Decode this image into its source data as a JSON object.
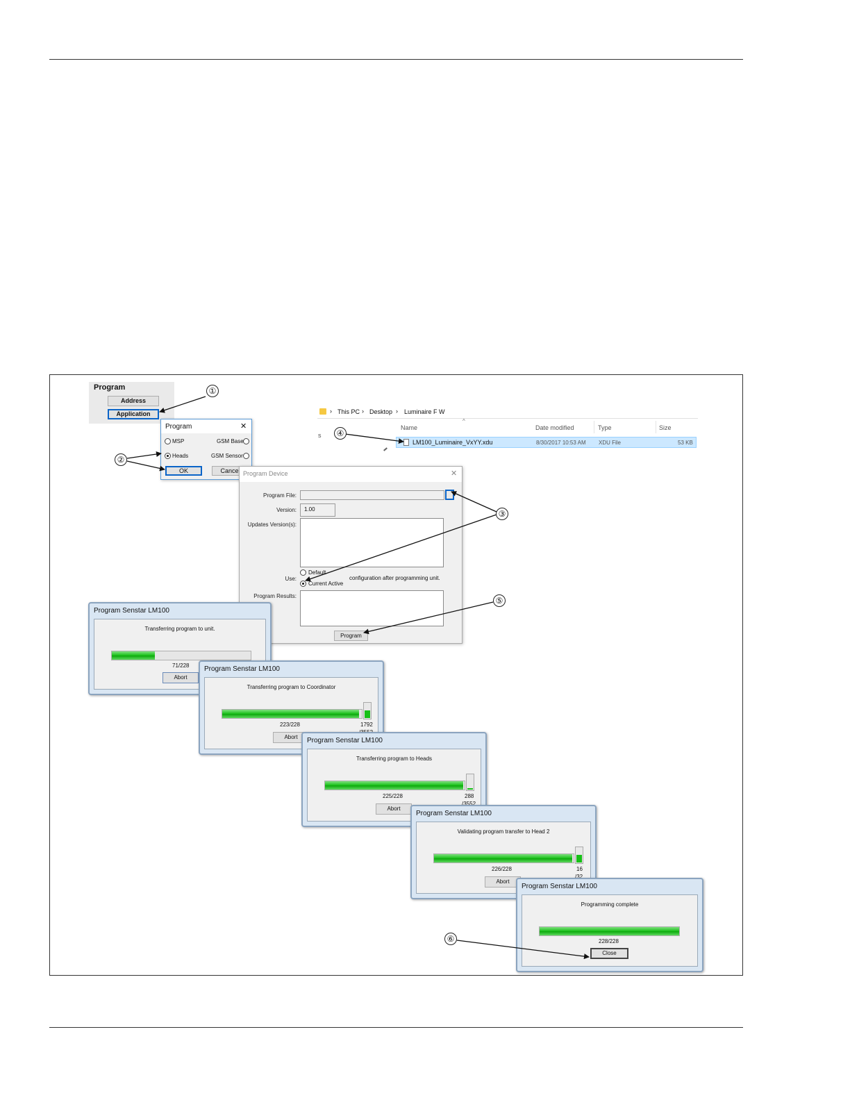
{
  "program_panel": {
    "title": "Program",
    "address_button": "Address",
    "application_button": "Application"
  },
  "program_dialog": {
    "title": "Program",
    "close_glyph": "✕",
    "option_msp": "MSP",
    "option_heads": "Heads",
    "option_gsm_base": "GSM Base",
    "option_gsm_sensor": "GSM Sensor",
    "ok_button": "OK",
    "cancel_button": "Cancel",
    "selected": "Heads"
  },
  "explorer": {
    "breadcrumb": [
      "This PC",
      "Desktop",
      "Luminaire F W"
    ],
    "separator": "›",
    "columns": {
      "name": "Name",
      "date": "Date modified",
      "type": "Type",
      "size": "Size"
    },
    "sort_glyph": "^",
    "side_letter": "s",
    "file": {
      "name": "LM100_Luminaire_VxYY.xdu",
      "date": "8/30/2017 10:53 AM",
      "type": "XDU File",
      "size": "53 KB"
    }
  },
  "program_device": {
    "title": "Program Device",
    "close_glyph": "✕",
    "program_file_label": "Program File:",
    "version_label": "Version:",
    "version_value": "1.00",
    "updates_label": "Updates Version(s):",
    "use_label": "Use:",
    "option_default": "Default",
    "option_current": "Current Active",
    "use_suffix": "configuration after programming unit.",
    "results_label": "Program Results:",
    "program_button": "Program"
  },
  "progress_windows": [
    {
      "title": "Program Senstar LM100",
      "message": "Transferring program to unit.",
      "progress": 0.31,
      "count": "71/228",
      "button": "Abort"
    },
    {
      "title": "Program Senstar LM100",
      "message": "Transferring program to Coordinator",
      "progress": 0.98,
      "count": "223/228",
      "sub_count": "1792",
      "sub_total": "/3552",
      "sub_progress": 0.5,
      "button": "Abort"
    },
    {
      "title": "Program Senstar LM100",
      "message": "Transferring program to Heads",
      "progress": 0.99,
      "count": "225/228",
      "sub_count": "288",
      "sub_total": "/3552",
      "sub_progress": 0.08,
      "button": "Abort"
    },
    {
      "title": "Program Senstar LM100",
      "message": "Validating program transfer to Head 2",
      "progress": 0.99,
      "count": "226/228",
      "sub_count": "16",
      "sub_total": "/32",
      "sub_progress": 0.5,
      "button": "Abort"
    },
    {
      "title": "Program Senstar LM100",
      "message": "Programming complete",
      "progress": 1.0,
      "count": "228/228",
      "button": "Close"
    }
  ],
  "callouts": [
    "①",
    "②",
    "③",
    "④",
    "⑤",
    "⑥"
  ],
  "colors": {
    "progress_green": "#17c017",
    "selection_blue": "#cce8ff",
    "focus_blue": "#0a64c8",
    "rule": "#333333"
  }
}
